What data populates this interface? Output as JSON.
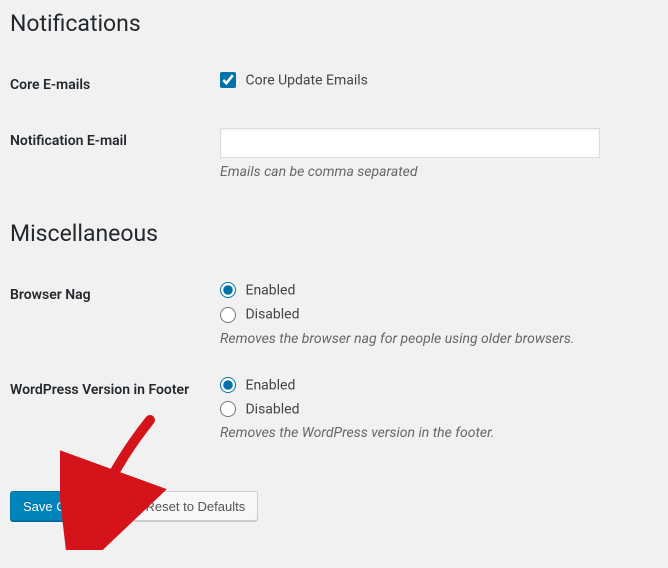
{
  "sections": {
    "notifications": {
      "heading": "Notifications",
      "coreEmails": {
        "label": "Core E-mails",
        "checkboxLabel": "Core Update Emails",
        "checked": true
      },
      "notificationEmail": {
        "label": "Notification E-mail",
        "value": "",
        "description": "Emails can be comma separated"
      }
    },
    "miscellaneous": {
      "heading": "Miscellaneous",
      "browserNag": {
        "label": "Browser Nag",
        "enabled": "Enabled",
        "disabled": "Disabled",
        "description": "Removes the browser nag for people using older browsers."
      },
      "wpVersion": {
        "label": "WordPress Version in Footer",
        "enabled": "Enabled",
        "disabled": "Disabled",
        "description": "Removes the WordPress version in the footer."
      }
    }
  },
  "buttons": {
    "save": "Save Changes",
    "reset": "Reset to Defaults"
  }
}
